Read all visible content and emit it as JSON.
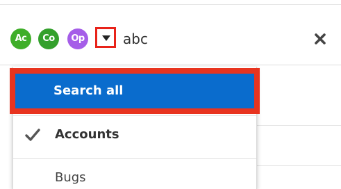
{
  "search_bar": {
    "modules": [
      {
        "label": "Ac",
        "color": "#3fae29"
      },
      {
        "label": "Co",
        "color": "#33a02c"
      },
      {
        "label": "Op",
        "color": "#a55de8"
      }
    ],
    "query": "abc",
    "dropdown_icon": "caret-down-icon",
    "clear_icon": "close-icon"
  },
  "menu": {
    "search_all_label": "Search all",
    "items": [
      {
        "label": "Accounts",
        "selected": true
      },
      {
        "label": "Bugs",
        "selected": false
      }
    ]
  },
  "colors": {
    "highlight": "#0a6ccd",
    "annotation": "#e8341f"
  }
}
